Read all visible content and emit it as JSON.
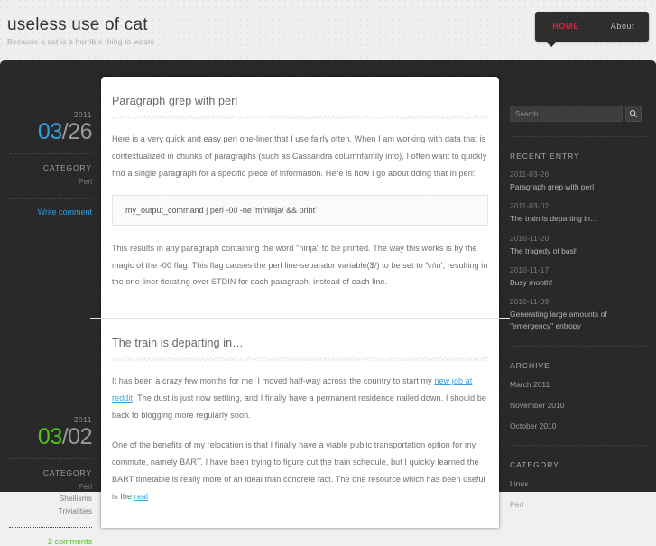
{
  "header": {
    "site_title": "useless use of cat",
    "tagline": "Because a cat is a horrible thing to waste",
    "nav": [
      {
        "label": "HOME",
        "active": true
      },
      {
        "label": "About",
        "active": false
      }
    ],
    "accent_red": "#e0213b"
  },
  "posts": [
    {
      "meta": {
        "year": "2011",
        "month": "03",
        "day": "/26",
        "month_color": "#2c9fe0",
        "category_label": "CATEGORY",
        "categories": [
          "Perl"
        ],
        "comment_link": "Write comment"
      },
      "title": "Paragraph grep with perl",
      "paragraph_1": "Here is a very quick and easy perl one-liner that I use fairly often. When I am working with data that is contextualized in chunks of paragraphs (such as Cassandra columnfamily info), I often want to quickly find a single paragraph for a specific piece of information. Here is how I go about doing that in perl:",
      "code": "my_output_command | perl -00 -ne 'm/ninja/ && print'",
      "paragraph_2": "This results in any paragraph containing the word \"ninja\" to be printed. The way this works is by the magic of the -00 flag. This flag causes the perl line-separator variable($/) to be set to '\\n\\n', resulting in the one-liner iterating over STDIN for each paragraph, instead of each line."
    },
    {
      "meta": {
        "year": "2011",
        "month": "03",
        "day": "/02",
        "month_color": "#4fc31a",
        "category_label": "CATEGORY",
        "categories": [
          "Perl",
          "Shellisms",
          "Trivialities"
        ],
        "comment_link": "2 comments"
      },
      "title": "The train is departing in…",
      "paragraph_1_pre": "It has been a crazy few months for me. I moved half-way across the country to start my ",
      "paragraph_1_link": "new job at reddit",
      "paragraph_1_post": ". The dust is just now settling, and I finally have a permanent residence nailed down. I should be back to blogging more regularly soon.",
      "paragraph_2_pre": "One of the benefits of my relocation is that I finally have a viable public transportation option for my commute, namely BART. I have been trying to figure out the train schedule, but I quickly learned the BART timetable is really more of an ideal than concrete fact. The one resource which has been useful is the ",
      "paragraph_2_link": "real"
    }
  ],
  "sidebar": {
    "search": {
      "placeholder": "Search",
      "value": "",
      "button_icon": "search-icon"
    },
    "recent_entry": {
      "heading": "RECENT ENTRY",
      "items": [
        {
          "date": "2011-03-26",
          "title": "Paragraph grep with perl"
        },
        {
          "date": "2011-03-02",
          "title": "The train is departing in…"
        },
        {
          "date": "2010-11-20",
          "title": "The tragedy of bash"
        },
        {
          "date": "2010-11-17",
          "title": "Busy month!"
        },
        {
          "date": "2010-11-09",
          "title": "Generating large amounts of \"emergency\" entropy"
        }
      ]
    },
    "archive": {
      "heading": "ARCHIVE",
      "items": [
        "March 2011",
        "November 2010",
        "October 2010"
      ]
    },
    "category": {
      "heading": "CATEGORY",
      "items": [
        "Linux",
        "Perl"
      ]
    }
  }
}
